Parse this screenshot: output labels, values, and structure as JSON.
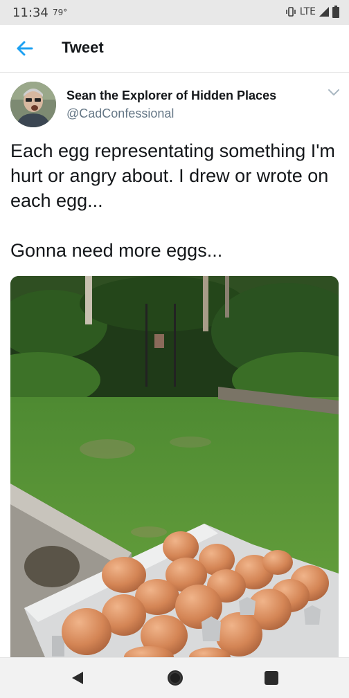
{
  "status_bar": {
    "time": "11:34",
    "temperature": "79°",
    "network": "LTE",
    "icons": [
      "vibrate-icon",
      "signal-icon",
      "battery-icon"
    ]
  },
  "app_bar": {
    "title": "Tweet",
    "back_icon": "arrow-left-icon",
    "accent_color": "#1da1f2"
  },
  "tweet": {
    "author_name": "Sean the Explorer of Hidden Places",
    "author_handle": "@CadConfessional",
    "text": "Each egg representating something I'm hurt or angry about. I drew or wrote on each egg...\n\nGonna need more eggs...",
    "menu_icon": "chevron-down-icon",
    "photo_description_icon": "photo"
  },
  "nav_bar": {
    "icons": [
      "back-triangle-icon",
      "home-circle-icon",
      "recents-square-icon"
    ]
  }
}
